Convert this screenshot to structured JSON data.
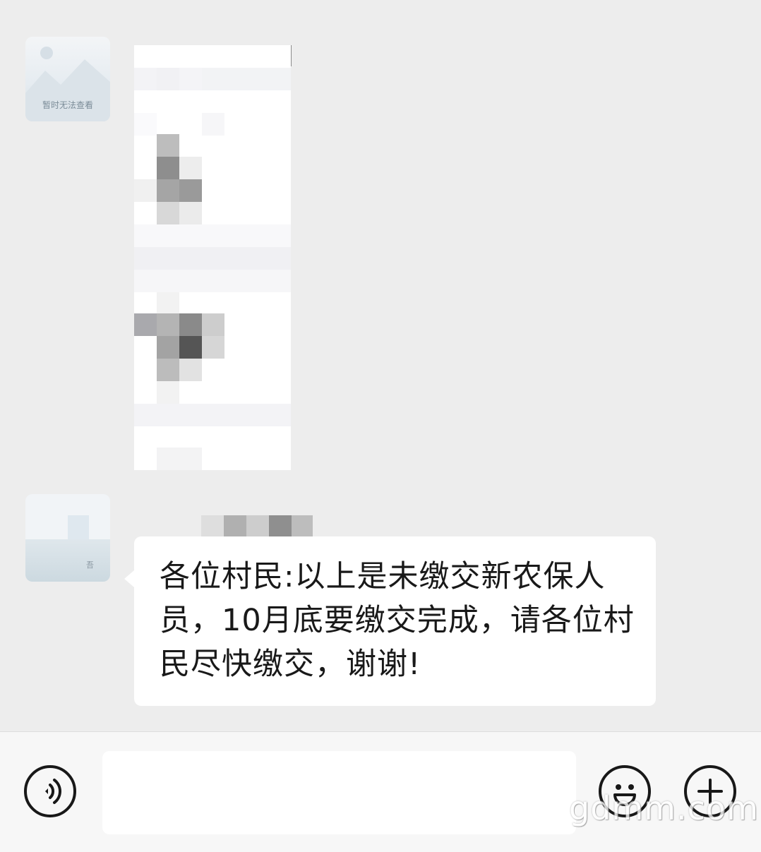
{
  "messages": [
    {
      "avatar": {
        "caption": "暂时无法查看"
      },
      "type": "image"
    },
    {
      "avatar": {
        "caption": "吾"
      },
      "type": "text",
      "text": "各位村民:以上是未缴交新农保人员，10月底要缴交完成，请各位村民尽快缴交，谢谢!"
    }
  ],
  "input_bar": {
    "voice_icon": "voice-icon",
    "input_value": "",
    "emoji_icon": "smiley-icon",
    "plus_icon": "plus-icon"
  },
  "watermark": "gdmm.com"
}
